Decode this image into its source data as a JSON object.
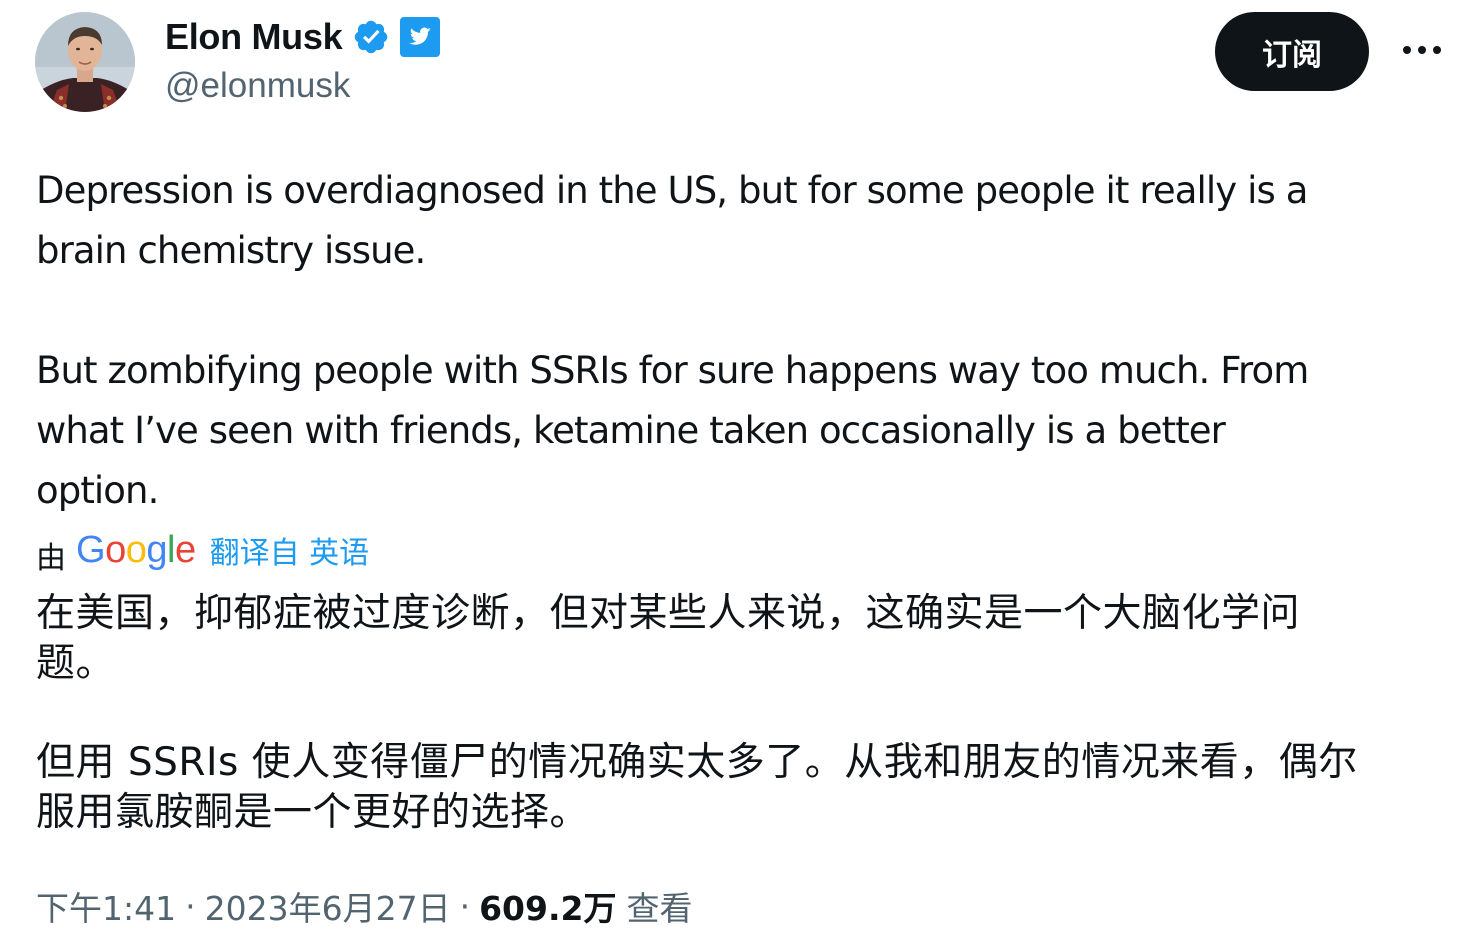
{
  "author": {
    "display_name": "Elon Musk",
    "handle": "@elonmusk",
    "verified_icon": "verified-badge-icon",
    "platform_icon": "twitter-bird-icon"
  },
  "actions": {
    "subscribe_label": "订阅",
    "more_icon": "more-horizontal-icon"
  },
  "tweet": {
    "original_lines_p1": [
      "Depression is overdiagnosed in the US, but for some people it really is a",
      "brain chemistry issue."
    ],
    "original_lines_p2": [
      "But zombifying people with SSRIs for sure happens way too much. From",
      "what I’ve seen with friends, ketamine taken occasionally is a better",
      "option."
    ]
  },
  "translation": {
    "by_label": "由",
    "provider": "Google",
    "link_label": "翻译自 英语",
    "lines_p1": [
      "在美国，抑郁症被过度诊断，但对某些人来说，这确实是一个大脑化学问",
      "题。"
    ],
    "lines_p2": [
      "但用 SSRIs 使人变得僵尸的情况确实太多了。从我和朋友的情况来看，偶尔",
      "服用氯胺酮是一个更好的选择。"
    ]
  },
  "meta": {
    "time": "下午1:41",
    "separator": "·",
    "date": "2023年6月27日",
    "views_count": "609.2万",
    "views_label": "查看"
  },
  "colors": {
    "text_primary": "#0f1419",
    "text_secondary": "#536471",
    "link_blue": "#1d9bf0",
    "button_bg": "#0f1419",
    "google_blue": "#4285F4",
    "google_red": "#EA4335",
    "google_yellow": "#FBBC05",
    "google_green": "#34A853"
  }
}
